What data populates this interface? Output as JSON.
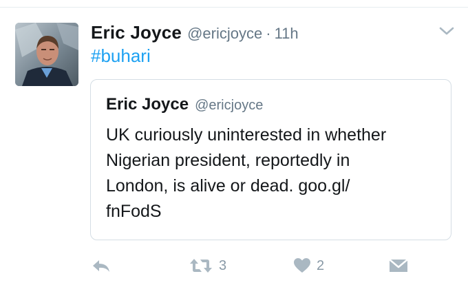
{
  "tweet": {
    "author": {
      "display_name": "Eric Joyce",
      "handle": "@ericjoyce"
    },
    "separator": "·",
    "time": "11h",
    "text": "#buhari",
    "quoted": {
      "display_name": "Eric Joyce",
      "handle": "@ericjoyce",
      "lines": [
        "UK curiously uninterested in whether",
        "Nigerian president, reportedly in",
        "London, is alive or dead. goo.gl/",
        "fnFodS"
      ]
    },
    "actions": {
      "reply_icon": "reply-icon",
      "retweet_icon": "retweet-icon",
      "retweet_count": "3",
      "like_icon": "heart-icon",
      "like_count": "2",
      "dm_icon": "envelope-icon"
    }
  },
  "colors": {
    "link": "#1da1f2",
    "secondary_text": "#657786",
    "action_gray": "#8899a6",
    "card_border": "#d4dde4"
  }
}
